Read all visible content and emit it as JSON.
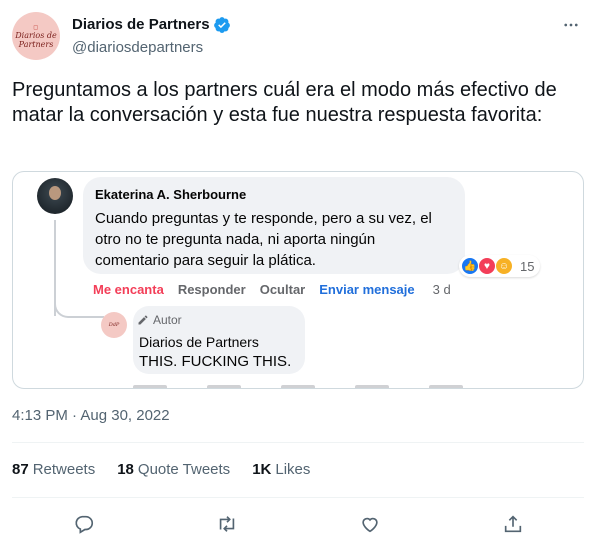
{
  "author": {
    "display_name": "Diarios de Partners",
    "handle": "@diariosdepartners",
    "verified": true,
    "avatar_logo_text": "Diarios de Partners"
  },
  "tweet": {
    "text": "Preguntamos a los partners cuál era el modo más efectivo de matar la conversación y esta fue nuestra respuesta favorita:"
  },
  "media": {
    "comment": {
      "author": "Ekaterina A. Sherbourne",
      "text": "Cuando preguntas y te responde, pero a su vez, el otro no te pregunta nada, ni aporta ningún comentario para seguir la plática.",
      "reaction_count": "15",
      "actions": {
        "love": "Me encanta",
        "reply": "Responder",
        "hide": "Ocultar",
        "send_message": "Enviar mensaje",
        "time": "3 d"
      }
    },
    "reply": {
      "tag": "Autor",
      "author": "Diarios de Partners",
      "text": "THIS. FUCKING THIS."
    }
  },
  "meta": {
    "timestamp": "4:13 PM · Aug 30, 2022"
  },
  "stats": {
    "retweets_count": "87",
    "retweets_label": "Retweets",
    "quotes_count": "18",
    "quotes_label": "Quote Tweets",
    "likes_count": "1K",
    "likes_label": "Likes"
  },
  "colors": {
    "verified": "#1d9bf0",
    "muted": "#536471",
    "fb_love": "#f33e58",
    "fb_link": "#216fdb"
  },
  "icons": [
    "more-icon",
    "verified-icon",
    "reply-icon",
    "retweet-icon",
    "like-icon",
    "share-icon"
  ]
}
